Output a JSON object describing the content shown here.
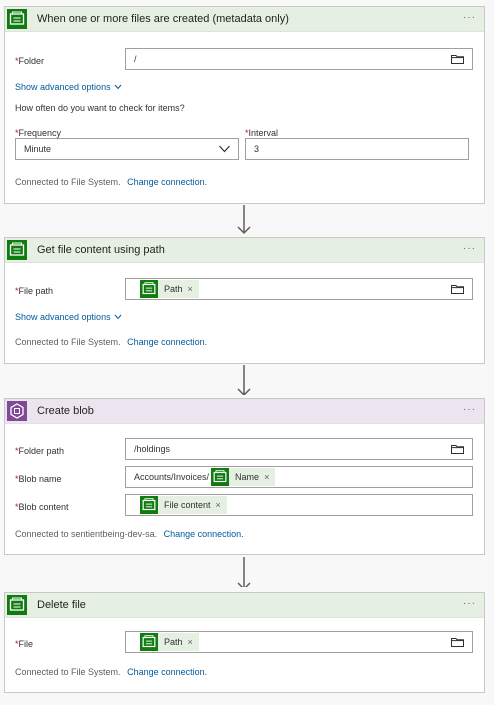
{
  "cards": [
    {
      "title": "When one or more files are created (metadata only)",
      "more": "···",
      "folder": {
        "label": "Folder",
        "required_mark": "*",
        "value": "/"
      },
      "advanced": "Show advanced options",
      "check_prompt": "How often do you want to check for items?",
      "frequency": {
        "label": "Frequency",
        "required_mark": "*",
        "value": "Minute"
      },
      "interval": {
        "label": "Interval",
        "required_mark": "*",
        "value": "3"
      },
      "connected": "Connected to File System.",
      "change": "Change connection."
    },
    {
      "title": "Get file content using path",
      "more": "···",
      "file_path": {
        "label": "File path",
        "required_mark": "*",
        "token": "Path",
        "token_remove": "×"
      },
      "advanced": "Show advanced options",
      "connected": "Connected to File System.",
      "change": "Change connection."
    },
    {
      "title": "Create blob",
      "more": "···",
      "folder_path": {
        "label": "Folder path",
        "required_mark": "*",
        "value": "/holdings"
      },
      "blob_name": {
        "label": "Blob name",
        "required_mark": "*",
        "prefix": "Accounts/Invoices/",
        "token": "Name",
        "token_remove": "×"
      },
      "blob_content": {
        "label": "Blob content",
        "required_mark": "*",
        "token": "File content",
        "token_remove": "×"
      },
      "connected": "Connected to sentientbeing-dev-sa.",
      "change": "Change connection."
    },
    {
      "title": "Delete file",
      "more": "···",
      "file": {
        "label": "File",
        "required_mark": "*",
        "token": "Path",
        "token_remove": "×"
      },
      "connected": "Connected to File System.",
      "change": "Change connection."
    }
  ],
  "icons": {
    "file_system": "file-system-icon",
    "blob_storage": "blob-storage-icon",
    "folder": "folder-icon",
    "chevron": "chevron-down-icon",
    "arrow": "arrow-down-icon"
  },
  "colors": {
    "file_system_brand": "#107c10",
    "blob_brand": "#804998",
    "link": "#005a9e",
    "required": "#a4262c"
  }
}
